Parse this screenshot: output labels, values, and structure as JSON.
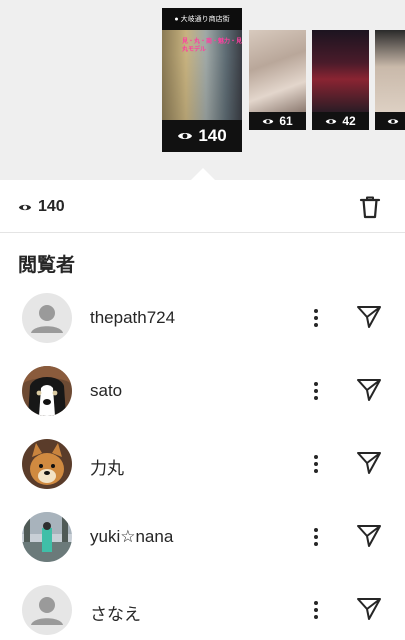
{
  "stories": {
    "main": {
      "header_text": "大岐通り商店街",
      "caption": "見・丸・商・魅力・見 丸モデル",
      "views": "140"
    },
    "others": [
      {
        "views": "61"
      },
      {
        "views": "42"
      },
      {
        "views": ""
      }
    ]
  },
  "count_bar": {
    "views": "140"
  },
  "viewers_title": "閲覧者",
  "viewers": [
    {
      "name": "thepath724",
      "avatar": "default"
    },
    {
      "name": "sato",
      "avatar": "dog-black-white"
    },
    {
      "name": "力丸",
      "avatar": "shiba"
    },
    {
      "name": "yuki☆nana",
      "avatar": "outdoor-photo"
    },
    {
      "name": "さなえ",
      "avatar": "default"
    }
  ],
  "colors": {
    "text": "#262626",
    "divider": "#e4e4e4",
    "strip_bg": "#efefef",
    "default_avatar_bg": "#e6e6e6",
    "default_avatar_fg": "#9a9a9a"
  }
}
